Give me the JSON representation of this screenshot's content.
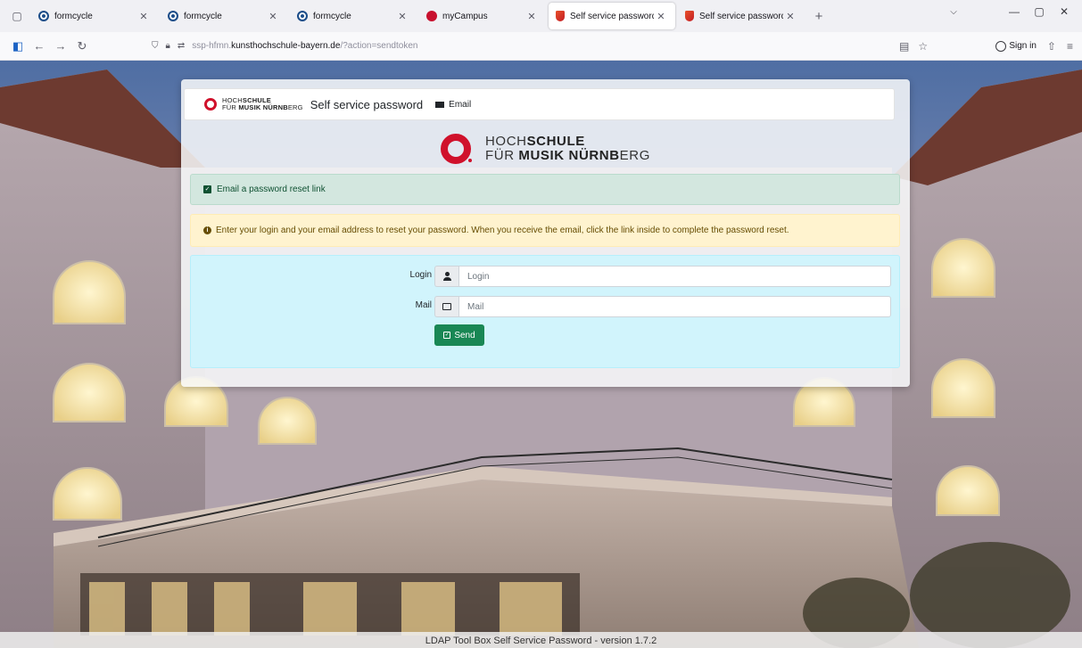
{
  "browser": {
    "tabs": [
      {
        "title": "formcycle",
        "favicon": "formcycle-icon",
        "active": false
      },
      {
        "title": "formcycle",
        "favicon": "formcycle-icon",
        "active": false
      },
      {
        "title": "formcycle",
        "favicon": "formcycle-icon",
        "active": false
      },
      {
        "title": "myCampus",
        "favicon": "mycampus-icon",
        "active": false
      },
      {
        "title": "Self service password",
        "favicon": "ssp-icon",
        "active": true
      },
      {
        "title": "Self service password",
        "favicon": "ssp-icon",
        "active": false
      }
    ],
    "url_prefix": "ssp-hfmn.",
    "url_domain": "kunsthochschule-bayern.de",
    "url_path": "/?action=sendtoken",
    "sign_in_label": "Sign in"
  },
  "header": {
    "logo_line1_a": "HOCH",
    "logo_line1_b": "SCHULE",
    "logo_line2_a": "FÜR ",
    "logo_line2_b": "MUSIK NÜRNB",
    "logo_line2_c": "ERG",
    "brand_title": "Self service password",
    "nav_email": "Email"
  },
  "big_logo": {
    "line1_a": "HOCH",
    "line1_b": "SCHULE",
    "line2_a": "FÜR ",
    "line2_b": "MUSIK NÜRNB",
    "line2_c": "ERG"
  },
  "alerts": {
    "success": "Email a password reset link",
    "info": "Enter your login and your email address to reset your password. When you receive the email, click the link inside to complete the password reset."
  },
  "form": {
    "login_label": "Login",
    "login_placeholder": "Login",
    "mail_label": "Mail",
    "mail_placeholder": "Mail",
    "send_label": "Send"
  },
  "footer": {
    "text": "LDAP Tool Box Self Service Password - version 1.7.2"
  },
  "colors": {
    "brand_red": "#d0112b",
    "success_bg": "#d1e7dd",
    "warning_bg": "#fff3cd",
    "info_bg": "#cff4fc",
    "send_button": "#198754"
  }
}
